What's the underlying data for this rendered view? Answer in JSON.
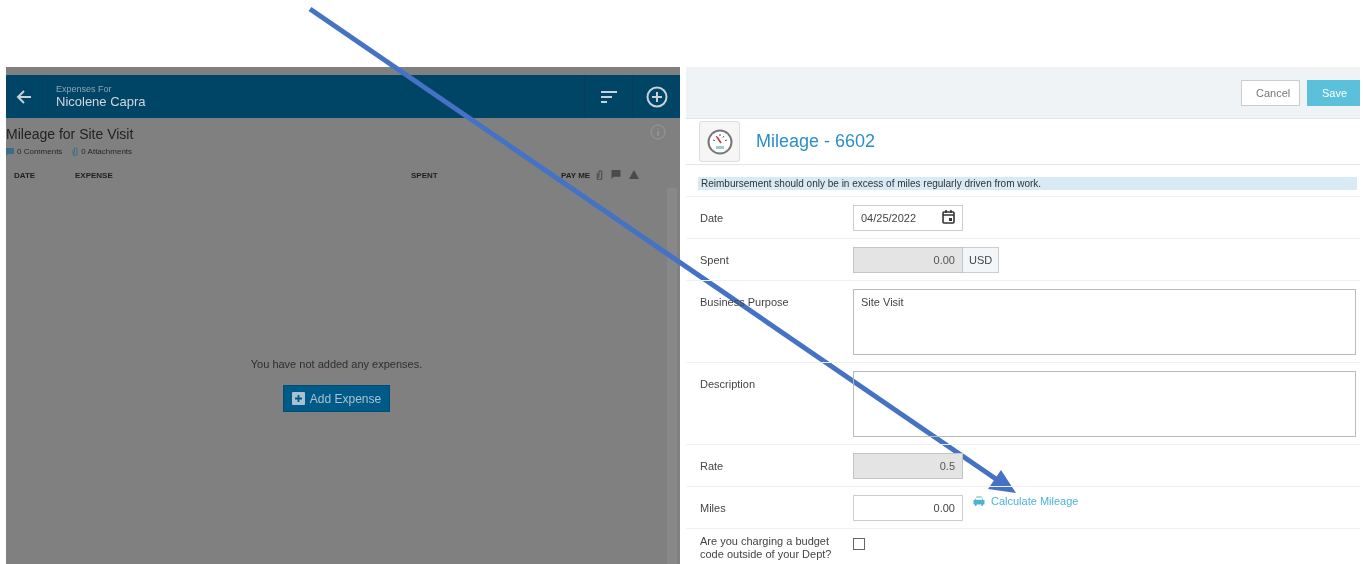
{
  "expenses_panel": {
    "header_caption": "Expenses For",
    "header_name": "Nicolene Capra",
    "report_title": "Mileage for Site Visit",
    "comments": "0 Comments",
    "attachments": "0 Attachments",
    "columns": [
      {
        "kind": "date",
        "label": "DATE"
      },
      {
        "kind": "expense",
        "label": "EXPENSE"
      },
      {
        "kind": "spent",
        "label": "SPENT"
      },
      {
        "kind": "payme",
        "label": "PAY ME"
      }
    ],
    "empty_message": "You have not added any expenses.",
    "add_button": "Add Expense"
  },
  "form_panel": {
    "buttons": [
      {
        "label": "Cancel",
        "kind": "secondary"
      },
      {
        "label": "Save",
        "kind": "primary"
      }
    ],
    "title": "Mileage - 6602",
    "notice": "Reimbursement should only be in excess of miles regularly driven from work.",
    "fields": [
      {
        "kind": "date",
        "label": "Date",
        "value": "04/25/2022",
        "disabled": false
      },
      {
        "kind": "currency",
        "label": "Spent",
        "value": "0.00",
        "unit": "USD",
        "disabled": true
      },
      {
        "kind": "textarea",
        "label": "Business Purpose",
        "value": "Site Visit"
      },
      {
        "kind": "textarea",
        "label": "Description"
      },
      {
        "kind": "number",
        "label": "Rate",
        "value": "0.5",
        "disabled": true
      },
      {
        "kind": "number",
        "label": "Miles",
        "value": "0.00",
        "disabled": false,
        "link": "Calculate Mileage"
      },
      {
        "kind": "checkbox",
        "label": "Are you charging a budget code outside of your Dept?",
        "checked": false
      }
    ]
  }
}
